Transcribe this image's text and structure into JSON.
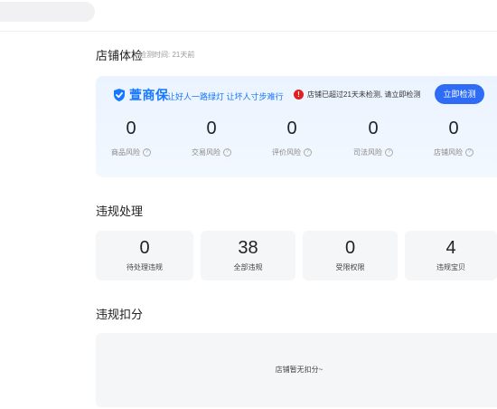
{
  "health": {
    "title": "店铺体检",
    "checked_time": "检测时间: 21天前",
    "brand_name": "萱商保",
    "slogan": "让好人一路绿灯 让坏人寸步难行",
    "alert_text": "店铺已超过21天未检测, 请立即检测",
    "check_button": "立即检测",
    "risks": [
      {
        "value": "0",
        "label": "商品风险"
      },
      {
        "value": "0",
        "label": "交易风险"
      },
      {
        "value": "0",
        "label": "评价风险"
      },
      {
        "value": "0",
        "label": "司法风险"
      },
      {
        "value": "0",
        "label": "店铺风险"
      }
    ]
  },
  "violation": {
    "title": "违规处理",
    "cards": [
      {
        "value": "0",
        "label": "待处理违规"
      },
      {
        "value": "38",
        "label": "全部违规"
      },
      {
        "value": "0",
        "label": "受限权限"
      },
      {
        "value": "4",
        "label": "违规宝贝"
      }
    ]
  },
  "deduction": {
    "title": "违规扣分",
    "empty_text": "店铺暂无扣分~"
  },
  "colors": {
    "accent": "#2e6cf6",
    "brand": "#1677ff",
    "alert": "#e02020"
  }
}
